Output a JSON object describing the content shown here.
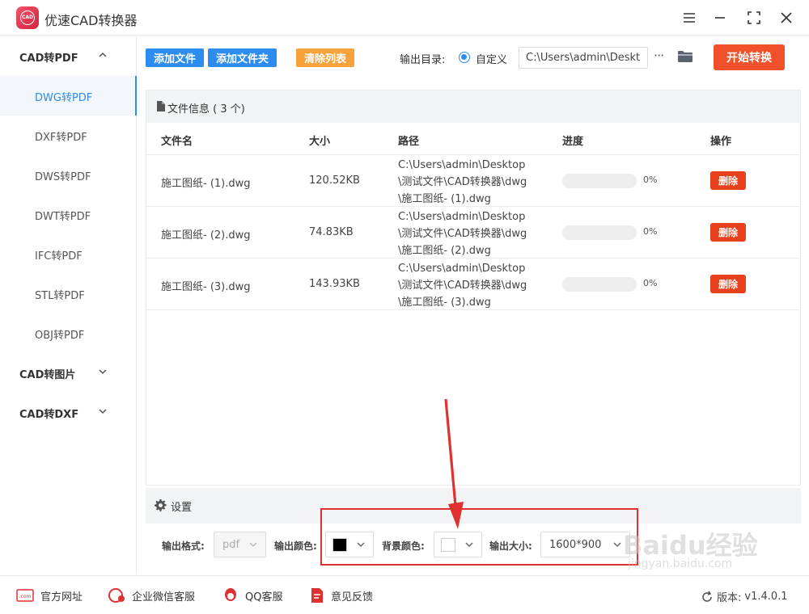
{
  "app": {
    "title": "优速CAD转换器",
    "logo_text": "CAD"
  },
  "sidebar": {
    "groups": [
      {
        "label": "CAD转PDF",
        "items": [
          "DWG转PDF",
          "DXF转PDF",
          "DWS转PDF",
          "DWT转PDF",
          "IFC转PDF",
          "STL转PDF",
          "OBJ转PDF"
        ],
        "active": "DWG转PDF"
      },
      {
        "label": "CAD转图片"
      },
      {
        "label": "CAD转DXF"
      }
    ]
  },
  "toolbar": {
    "add_file": "添加文件",
    "add_folder": "添加文件夹",
    "clear_list": "清除列表",
    "output_dir_label": "输出目录:",
    "custom_label": "自定义",
    "path_value": "C:\\Users\\admin\\Deskto",
    "more": "···",
    "start": "开始转换"
  },
  "file_panel": {
    "title": "文件信息 ( 3 个)",
    "columns": [
      "文件名",
      "大小",
      "路径",
      "进度",
      "操作"
    ],
    "rows": [
      {
        "name": "施工图纸- (1).dwg",
        "size": "120.52KB",
        "path_l1": "C:\\Users\\admin\\Desktop",
        "path_l2": "\\测试文件\\CAD转换器\\dwg",
        "path_l3": "\\施工图纸- (1).dwg",
        "progress": 0,
        "progress_text": "0%",
        "action": "删除"
      },
      {
        "name": "施工图纸- (2).dwg",
        "size": "74.83KB",
        "path_l1": "C:\\Users\\admin\\Desktop",
        "path_l2": "\\测试文件\\CAD转换器\\dwg",
        "path_l3": "\\施工图纸- (2).dwg",
        "progress": 0,
        "progress_text": "0%",
        "action": "删除"
      },
      {
        "name": "施工图纸- (3).dwg",
        "size": "143.93KB",
        "path_l1": "C:\\Users\\admin\\Desktop",
        "path_l2": "\\测试文件\\CAD转换器\\dwg",
        "path_l3": "\\施工图纸- (3).dwg",
        "progress": 0,
        "progress_text": "0%",
        "action": "删除"
      }
    ]
  },
  "settings": {
    "title": "设置",
    "format_label": "输出格式:",
    "format_value": "pdf",
    "color_label": "输出颜色:",
    "color_value": "#000000",
    "bg_label": "背景颜色:",
    "bg_value": "#ffffff",
    "size_label": "输出大小:",
    "size_value": "1600*900"
  },
  "footer": {
    "website": "官方网址",
    "wechat": "企业微信客服",
    "qq": "QQ客服",
    "feedback": "意见反馈",
    "version_label": "版本:",
    "version_value": "v1.4.0.1"
  },
  "watermark": {
    "line1": "Baidu经验",
    "line2": "jingyan.baidu.com"
  },
  "colors": {
    "accent": "#2d8cf0",
    "start": "#f0502a",
    "delete": "#e8401c",
    "clear": "#f7a23a",
    "annotation": "#e03131"
  }
}
